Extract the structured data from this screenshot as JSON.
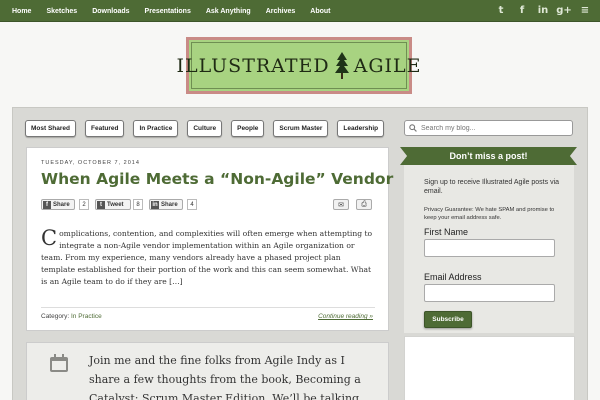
{
  "nav": [
    "Home",
    "Sketches",
    "Downloads",
    "Presentations",
    "Ask Anything",
    "Archives",
    "About"
  ],
  "social": [
    {
      "name": "twitter-icon",
      "glyph": "t"
    },
    {
      "name": "facebook-icon",
      "glyph": "f"
    },
    {
      "name": "linkedin-icon",
      "glyph": "in"
    },
    {
      "name": "google-plus-icon",
      "glyph": "g+"
    },
    {
      "name": "rss-icon",
      "glyph": "≡"
    }
  ],
  "logo": {
    "left": "ILLUSTRATED",
    "right": "AGILE"
  },
  "categories": [
    "Most Shared",
    "Featured",
    "In Practice",
    "Culture",
    "People",
    "Scrum Master",
    "Leadership"
  ],
  "search": {
    "placeholder": "Search my blog..."
  },
  "post": {
    "date": "TUESDAY, OCTOBER 7, 2014",
    "title": "When Agile Meets a “Non-Agile” Vendor",
    "share": {
      "facebook_label": "Share",
      "facebook_count": "2",
      "twitter_label": "Tweet",
      "twitter_count": "8",
      "linkedin_label": "Share",
      "linkedin_count": "4"
    },
    "excerpt_first": "C",
    "excerpt_rest": "omplications, contention, and complexities will often emerge when attempting to integrate a non-Agile vendor implementation within an Agile organization or team. From my experience, many vendors already have a phased project plan template established for their portion of the work and this can seem somewhat. What is an Agile team to do if they are […]",
    "category_label": "Category:",
    "category": "In Practice",
    "continue": "Continue reading »"
  },
  "post2": {
    "excerpt": "Join me and the fine folks from Agile Indy as I share a few thoughts from the book, Becoming a Catalyst: Scrum Master Edition. We’ll be talking"
  },
  "sidebar": {
    "ribbon": "Don’t miss a post!",
    "text": "Sign up to receive Illustrated Agile posts via email.",
    "privacy": "Privacy Guarantee: We hate SPAM and promise to keep your email address safe.",
    "first_name_label": "First Name",
    "email_label": "Email Address",
    "subscribe": "Subscribe"
  },
  "colors": {
    "brand_green": "#4e6b35",
    "logo_green": "#a8d381"
  }
}
